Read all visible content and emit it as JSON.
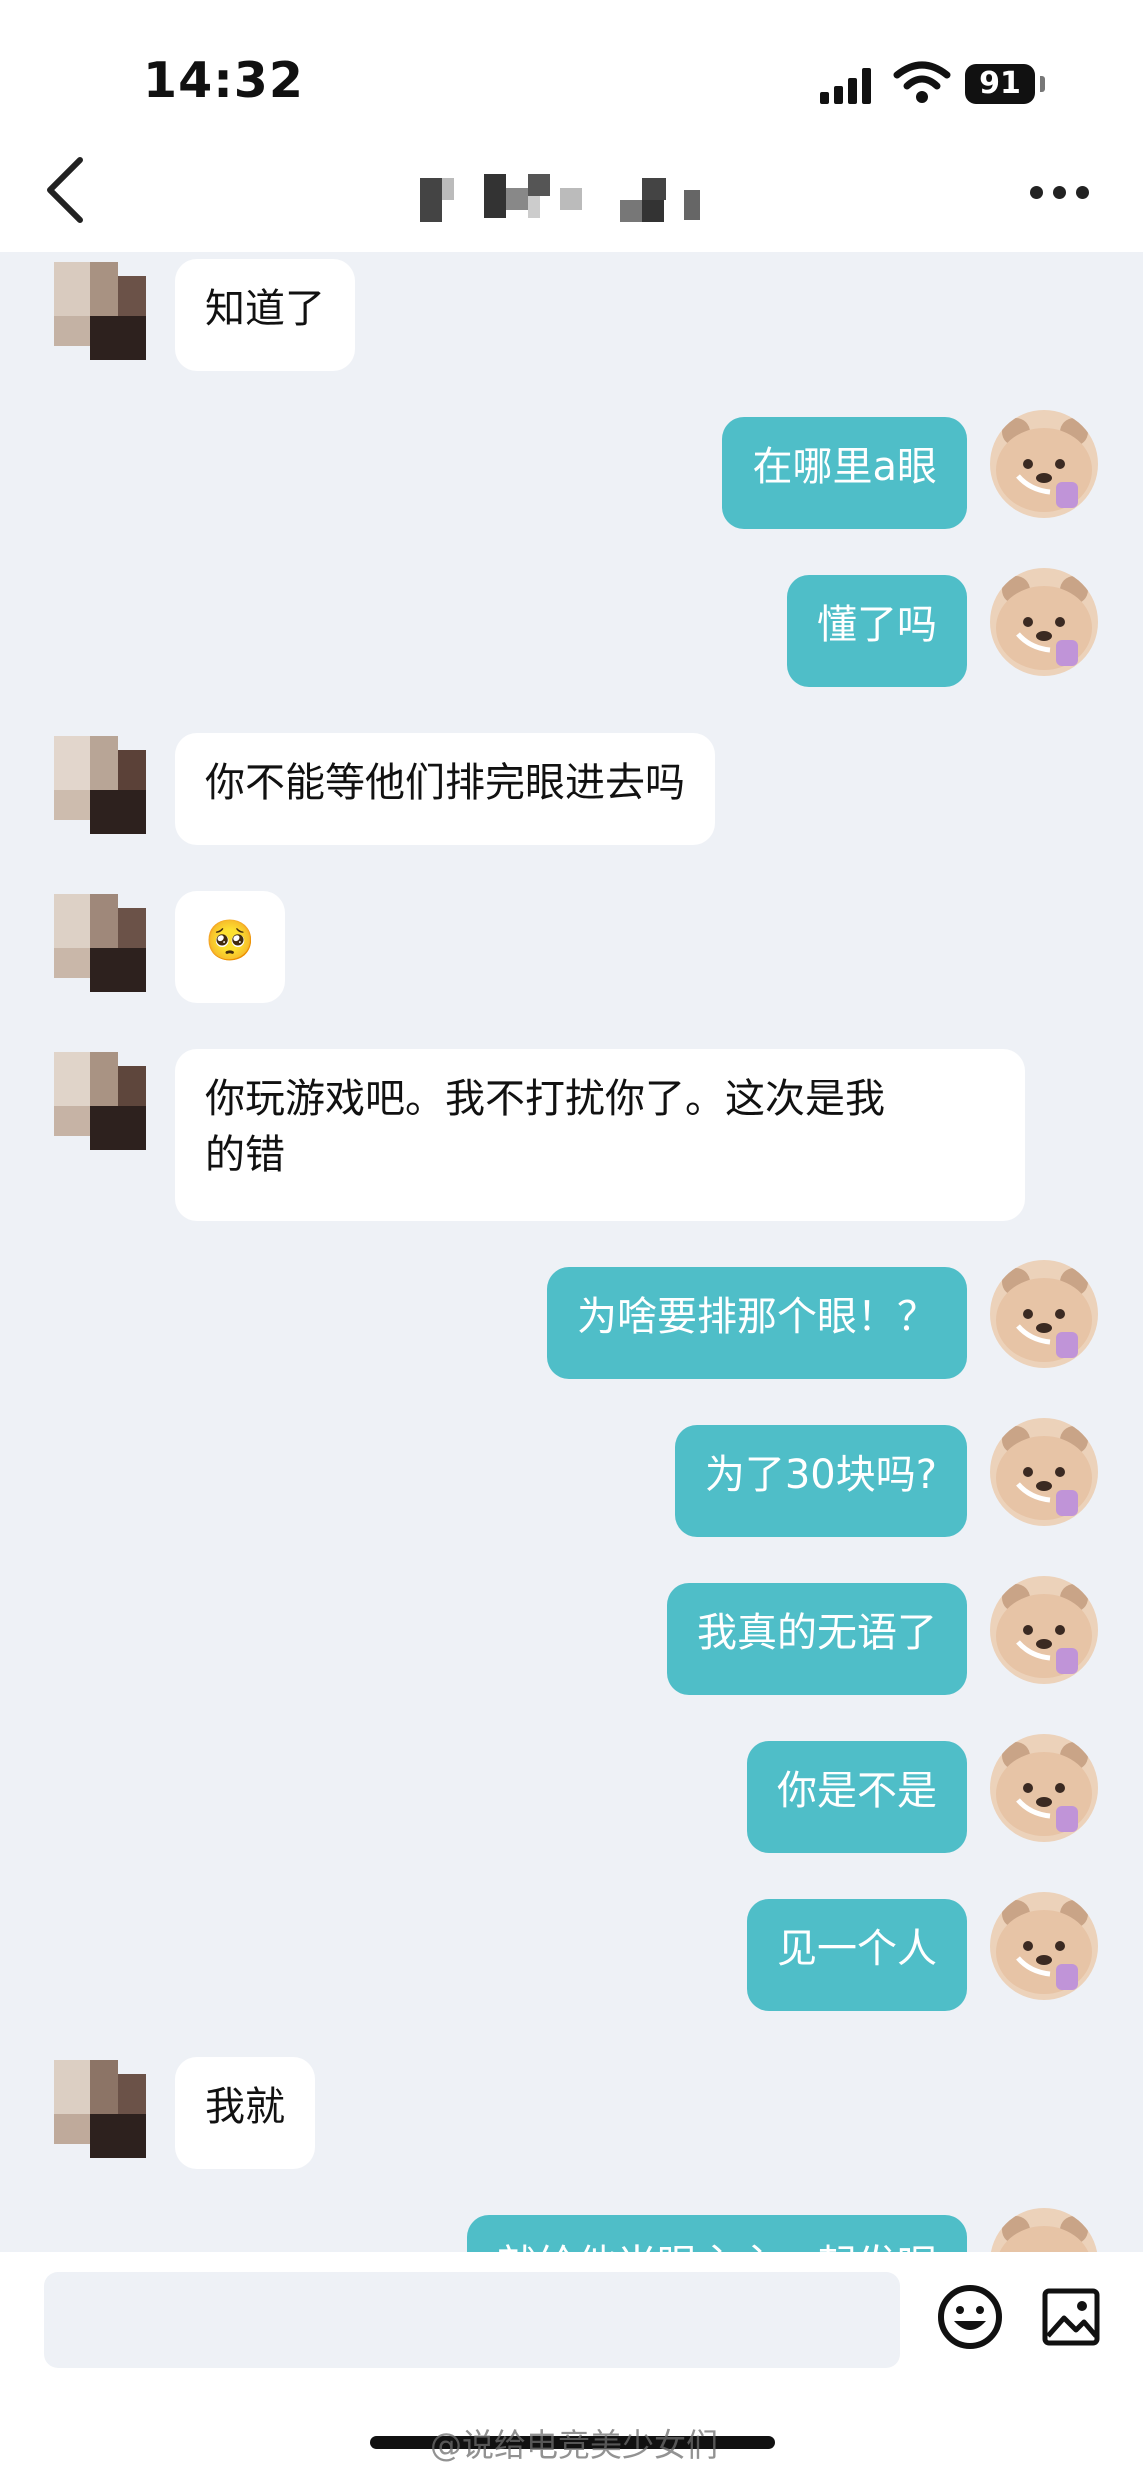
{
  "status_bar": {
    "time": "14:32",
    "battery": "91"
  },
  "header": {
    "title": ""
  },
  "messages": [
    {
      "side": "in",
      "text": "知道了"
    },
    {
      "side": "out",
      "text": "在哪里a眼"
    },
    {
      "side": "out",
      "text": "懂了吗"
    },
    {
      "side": "in",
      "text": "你不能等他们排完眼进去吗"
    },
    {
      "side": "in",
      "text": "🥺"
    },
    {
      "side": "in",
      "text": "你玩游戏吧。我不打扰你了。这次是我\n的错"
    },
    {
      "side": "out",
      "text": "为啥要排那个眼！？"
    },
    {
      "side": "out",
      "text": "为了30块吗?"
    },
    {
      "side": "out",
      "text": "我真的无语了"
    },
    {
      "side": "out",
      "text": "你是不是"
    },
    {
      "side": "out",
      "text": "见一个人"
    },
    {
      "side": "in",
      "text": "我就"
    },
    {
      "side": "out",
      "text": "就给他当眼主主一起发呢"
    }
  ],
  "composer": {
    "placeholder": "",
    "emoji_icon": "smiley-icon",
    "image_icon": "image-icon"
  },
  "watermark": "@说给电竞美少女们",
  "colors": {
    "outgoing_bubble": "#4fbec8",
    "incoming_bubble": "#ffffff",
    "chat_background": "#eef1f6"
  }
}
